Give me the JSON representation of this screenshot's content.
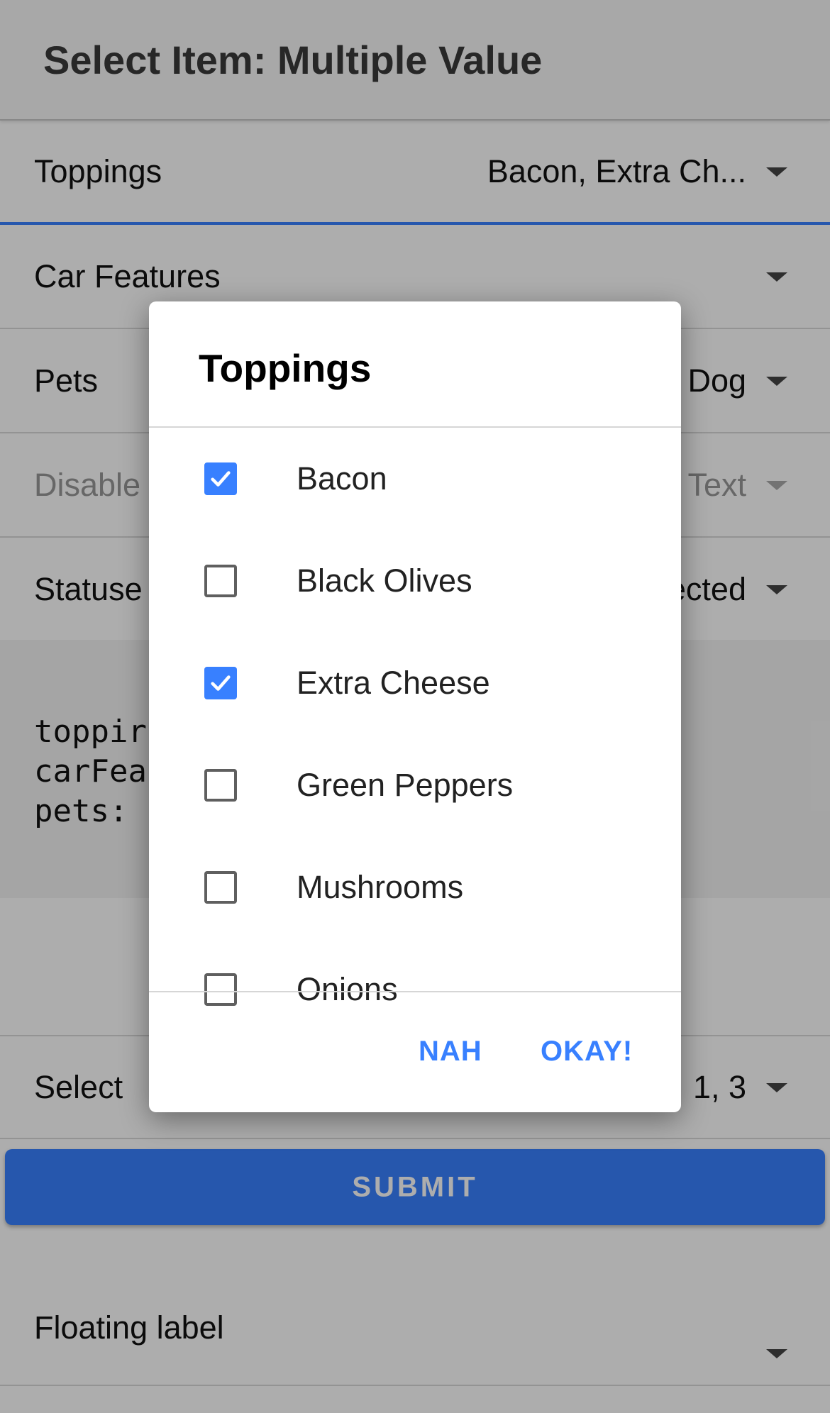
{
  "header": {
    "title": "Select Item: Multiple Value"
  },
  "form_rows": [
    {
      "label": "Toppings",
      "value": "Bacon, Extra Ch..."
    },
    {
      "label": "Car Features",
      "value": ""
    },
    {
      "label": "Pets",
      "value": ", Dog"
    },
    {
      "label": "Disable",
      "value": "Text"
    },
    {
      "label": "Statuse",
      "value": "ected"
    }
  ],
  "output": {
    "lines": [
      "toppir",
      "carFea",
      "pets:"
    ]
  },
  "select_row": {
    "label": "Select",
    "value": "1, 3"
  },
  "submit": {
    "label": "SUBMIT"
  },
  "floating": {
    "label": "Floating label"
  },
  "dialog": {
    "title": "Toppings",
    "options": [
      {
        "label": "Bacon",
        "checked": true
      },
      {
        "label": "Black Olives",
        "checked": false
      },
      {
        "label": "Extra Cheese",
        "checked": true
      },
      {
        "label": "Green Peppers",
        "checked": false
      },
      {
        "label": "Mushrooms",
        "checked": false
      },
      {
        "label": "Onions",
        "checked": false
      }
    ],
    "cancel_label": "NAH",
    "ok_label": "OKAY!"
  },
  "colors": {
    "accent": "#3880ff",
    "backdrop": "rgba(0,0,0,0.32)"
  }
}
